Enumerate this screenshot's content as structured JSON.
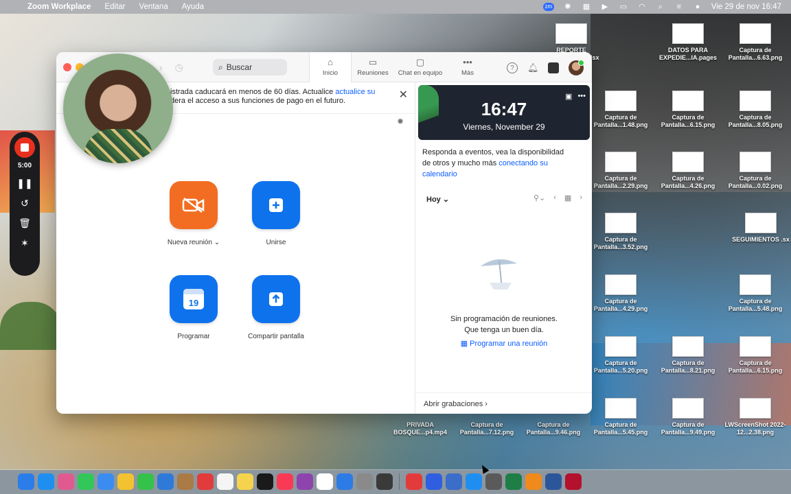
{
  "menubar": {
    "app": "Zoom Workplace",
    "items": [
      "Editar",
      "Ventana",
      "Ayuda"
    ],
    "clock": "Vie 29 de nov  16:47",
    "zm_badge": "zm"
  },
  "window": {
    "search_placeholder": "Buscar",
    "tabs": [
      {
        "label": "Inicio",
        "icon": "home-icon"
      },
      {
        "label": "Reuniones",
        "icon": "video-icon"
      },
      {
        "label": "Chat en equipo",
        "icon": "chat-icon"
      },
      {
        "label": "Más",
        "icon": "more-icon"
      }
    ],
    "banner_text": "istrada caducará en menos de 60 días. Actualice ",
    "banner_link": "actualice su",
    "banner_text2": "dera el acceso a sus funciones de pago en el futuro.",
    "actions": {
      "new_meeting": "Nueva reunión",
      "join": "Unirse",
      "schedule": "Programar",
      "share": "Compartir pantalla",
      "cal_day": "19"
    }
  },
  "right": {
    "time": "16:47",
    "date": "Viernes, November 29",
    "cal_text": "Responda a eventos, vea la disponibilidad de otros y mucho más ",
    "cal_link": "conectando su calendario",
    "today": "Hoy",
    "empty1": "Sin programación de reuniones.",
    "empty2": "Que tenga un buen día.",
    "schedule_link": "Programar una reunión",
    "recordings": "Abrir grabaciones"
  },
  "recorder": {
    "time": "5:00"
  },
  "desktop_icons": [
    {
      "label": "REPORTE COMISI...ON-5.xlsx"
    },
    {
      "label": "DATOS PARA EXPEDIE...IA.pages"
    },
    {
      "label": "Captura de Pantalla...6.63.png"
    },
    {
      "label": "Captura de Pantalla...1.48.png"
    },
    {
      "label": "Captura de Pantalla...6.15.png"
    },
    {
      "label": "Captura de Pantalla...8.05.png"
    },
    {
      "label": "Captura de Pantalla...2.29.png"
    },
    {
      "label": "Captura de Pantalla...4.26.png"
    },
    {
      "label": "Captura de Pantalla...0.02.png"
    },
    {
      "label": "Captura de Pantalla...3.52.png"
    },
    {
      "label": "SEGUIMIENTOS .sx"
    },
    {
      "label": "Captura de Pantalla...4.29.png"
    },
    {
      "label": "Captura de Pantalla...5.48.png"
    },
    {
      "label": "Captura de Pantalla...5.20.png"
    },
    {
      "label": "Captura de Pantalla...8.21.png"
    },
    {
      "label": "Captura de Pantalla...6.15.png"
    },
    {
      "label": "PRIVADA BOSQUE...p4.mp4"
    },
    {
      "label": "Captura de Pantalla...7.12.png"
    },
    {
      "label": "Captura de Pantalla...9.46.png"
    },
    {
      "label": "Captura de Pantalla...5.45.png"
    },
    {
      "label": "Captura de Pantalla...9.49.png"
    },
    {
      "label": "LWScreenShot 2022-12...2.38.png"
    }
  ],
  "dock_colors": [
    "#2b7de9",
    "#1f8ef1",
    "#e05a8f",
    "#33c75a",
    "#3b8cf0",
    "#f2c230",
    "#34c24a",
    "#2f7ad8",
    "#aa7b45",
    "#e23b3b",
    "#f5f5f5",
    "#f5d34c",
    "#1a1a1a",
    "#fa3a54",
    "#8e44ad",
    "#fff",
    "#2d7be5",
    "#8a8a8a",
    "#3a3a3a",
    "#e33b3b",
    "#2f5fe0",
    "#3b6ec9",
    "#1f8ef1",
    "#5a5a5a",
    "#1e7e45",
    "#f08a1c",
    "#2b579a",
    "#b3112e"
  ]
}
